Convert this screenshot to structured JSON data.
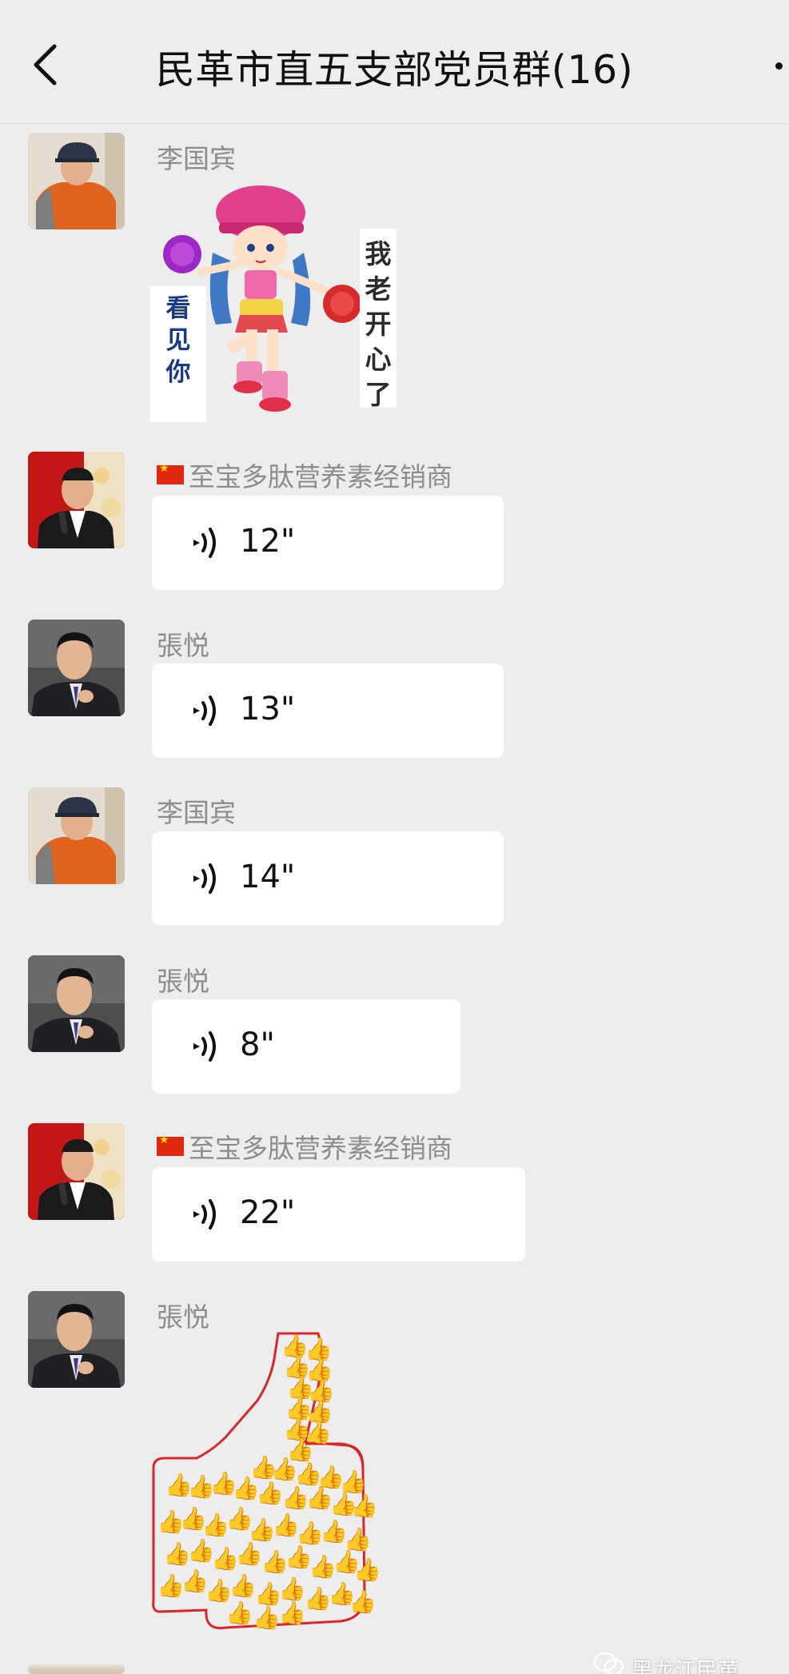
{
  "header": {
    "title": "民革市直五支部党员群(16)"
  },
  "messages": [
    {
      "sender": "李国宾",
      "type": "sticker",
      "sticker_text_left": [
        "看",
        "见",
        "你"
      ],
      "sticker_text_right": [
        "我",
        "老",
        "开",
        "心",
        "了"
      ]
    },
    {
      "sender": "至宝多肽营养素经销商",
      "sender_flag": "china-flag-icon",
      "type": "voice",
      "duration": "12\""
    },
    {
      "sender": "張悦",
      "type": "voice",
      "duration": "13\""
    },
    {
      "sender": "李国宾",
      "type": "voice",
      "duration": "14\""
    },
    {
      "sender": "張悦",
      "type": "voice",
      "duration": "8\""
    },
    {
      "sender": "至宝多肽营养素经销商",
      "sender_flag": "china-flag-icon",
      "type": "voice",
      "duration": "22\""
    },
    {
      "sender": "張悦",
      "type": "sticker",
      "sticker_name": "thumbs-up-made-of-thumbs"
    }
  ],
  "watermark": {
    "text": "黑龙江民革",
    "icon": "wechat-icon"
  },
  "colors": {
    "background": "#ededed",
    "bubble": "#ffffff",
    "sender_name": "#8d8d8d",
    "text": "#111111"
  }
}
